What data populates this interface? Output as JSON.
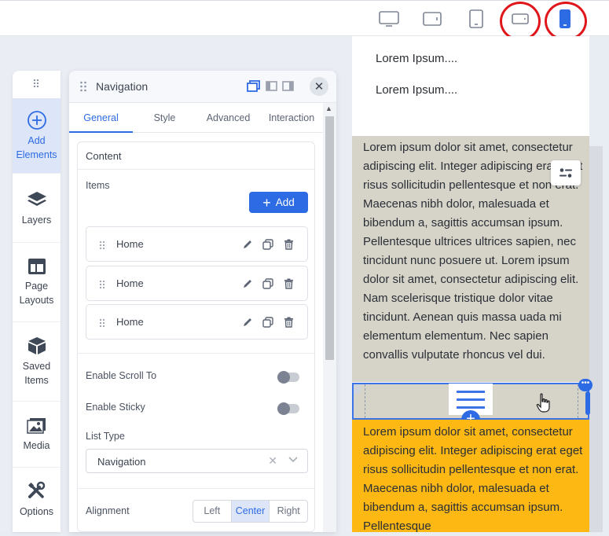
{
  "toolbar": {
    "devices": [
      "desktop-icon",
      "tablet-landscape-icon",
      "tablet-portrait-icon",
      "mobile-landscape-icon",
      "mobile-portrait-icon"
    ],
    "highlight_color": "#e0161b",
    "accent": "#2d6be4"
  },
  "rail": {
    "items": [
      {
        "label": "Add\nElements",
        "icon": "plus-circle-icon",
        "active": true
      },
      {
        "label": "Layers",
        "icon": "layers-icon"
      },
      {
        "label": "Page\nLayouts",
        "icon": "layout-icon"
      },
      {
        "label": "Saved\nItems",
        "icon": "box-icon"
      },
      {
        "label": "Media",
        "icon": "image-icon"
      },
      {
        "label": "Options",
        "icon": "tools-icon"
      }
    ]
  },
  "panel": {
    "title": "Navigation",
    "tabs": [
      "General",
      "Style",
      "Advanced",
      "Interaction"
    ],
    "active_tab": "General",
    "content_title": "Content",
    "items_label": "Items",
    "add_label": "Add",
    "nav_items": [
      "Home",
      "Home",
      "Home"
    ],
    "scroll_to_label": "Enable Scroll To",
    "sticky_label": "Enable Sticky",
    "list_type_label": "List Type",
    "list_type_value": "Navigation",
    "alignment_label": "Alignment",
    "alignment_options": [
      "Left",
      "Center",
      "Right"
    ],
    "alignment_selected": "Center"
  },
  "preview": {
    "menu_items": [
      "Lorem Ipsum....",
      "Lorem Ipsum...."
    ],
    "gray_paragraph": "Lorem ipsum dolor sit amet, consectetur adipiscing elit. Integer adipiscing erat eget risus sollicitudin pellentesque et non erat. Maecenas nibh dolor, malesuada et bibendum a, sagittis accumsan ipsum. Pellentesque ultrices ultrices sapien, nec tincidunt nunc posuere ut. Lorem ipsum dolor sit amet, consectetur adipiscing elit. Nam scelerisque tristique dolor vitae tincidunt. Aenean quis massa uada mi elementum elementum. Nec sapien convallis vulputate rhoncus vel dui.",
    "orange_paragraph": "Lorem ipsum dolor sit amet, consectetur adipiscing elit. Integer adipiscing erat eget risus sollicitudin pellentesque et non erat. Maecenas nibh dolor, malesuada et bibendum a, sagittis accumsan ipsum. Pellentesque",
    "gray_color": "#d6d3c9",
    "orange_color": "#fdb813"
  }
}
